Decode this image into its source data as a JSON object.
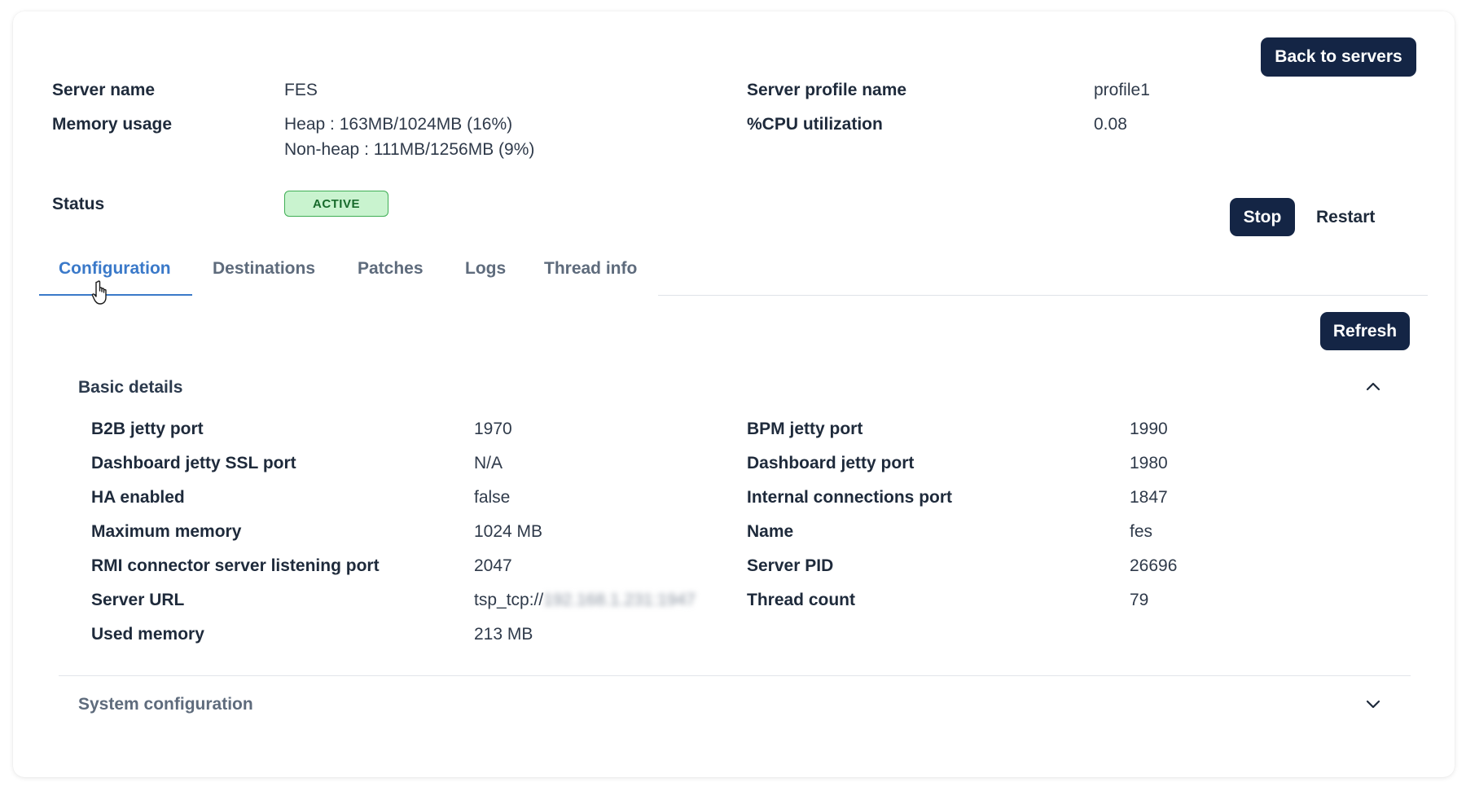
{
  "header": {
    "back_button": "Back to servers",
    "server_name_label": "Server name",
    "server_name_value": "FES",
    "server_profile_label": "Server profile name",
    "server_profile_value": "profile1",
    "memory_label": "Memory usage",
    "memory_heap": "Heap : 163MB/1024MB (16%)",
    "memory_nonheap": "Non-heap : 111MB/1256MB (9%)",
    "cpu_label": "%CPU utilization",
    "cpu_value": "0.08",
    "status_label": "Status",
    "status_value": "ACTIVE",
    "stop_button": "Stop",
    "restart_button": "Restart"
  },
  "tabs": [
    {
      "label": "Configuration",
      "active": true
    },
    {
      "label": "Destinations",
      "active": false
    },
    {
      "label": "Patches",
      "active": false
    },
    {
      "label": "Logs",
      "active": false
    },
    {
      "label": "Thread info",
      "active": false
    }
  ],
  "refresh_button": "Refresh",
  "basic_details": {
    "title": "Basic details",
    "expanded": true,
    "left": [
      {
        "label": "B2B jetty port",
        "value": "1970"
      },
      {
        "label": "Dashboard jetty SSL port",
        "value": "N/A"
      },
      {
        "label": "HA enabled",
        "value": "false"
      },
      {
        "label": "Maximum memory",
        "value": "1024 MB"
      },
      {
        "label": "RMI connector server listening port",
        "value": "2047"
      },
      {
        "label": "Server URL",
        "value": "tsp_tcp://",
        "value_redacted": "192.168.1.231:1947"
      },
      {
        "label": "Used memory",
        "value": "213 MB"
      }
    ],
    "right": [
      {
        "label": "BPM jetty port",
        "value": "1990"
      },
      {
        "label": "Dashboard jetty port",
        "value": "1980"
      },
      {
        "label": "Internal connections port",
        "value": "1847"
      },
      {
        "label": "Name",
        "value": "fes"
      },
      {
        "label": "Server PID",
        "value": "26696"
      },
      {
        "label": "Thread count",
        "value": "79"
      }
    ]
  },
  "system_configuration": {
    "title": "System configuration",
    "expanded": false
  },
  "colors": {
    "primary_button": "#142545",
    "active_tab": "#3a79c9",
    "status_bg": "#c9f3cf",
    "status_border": "#3fae55",
    "status_text": "#176a2b"
  },
  "icons": {
    "collapse": "chevron-up-icon",
    "expand": "chevron-down-icon",
    "cursor": "hand-pointer-cursor-icon"
  }
}
